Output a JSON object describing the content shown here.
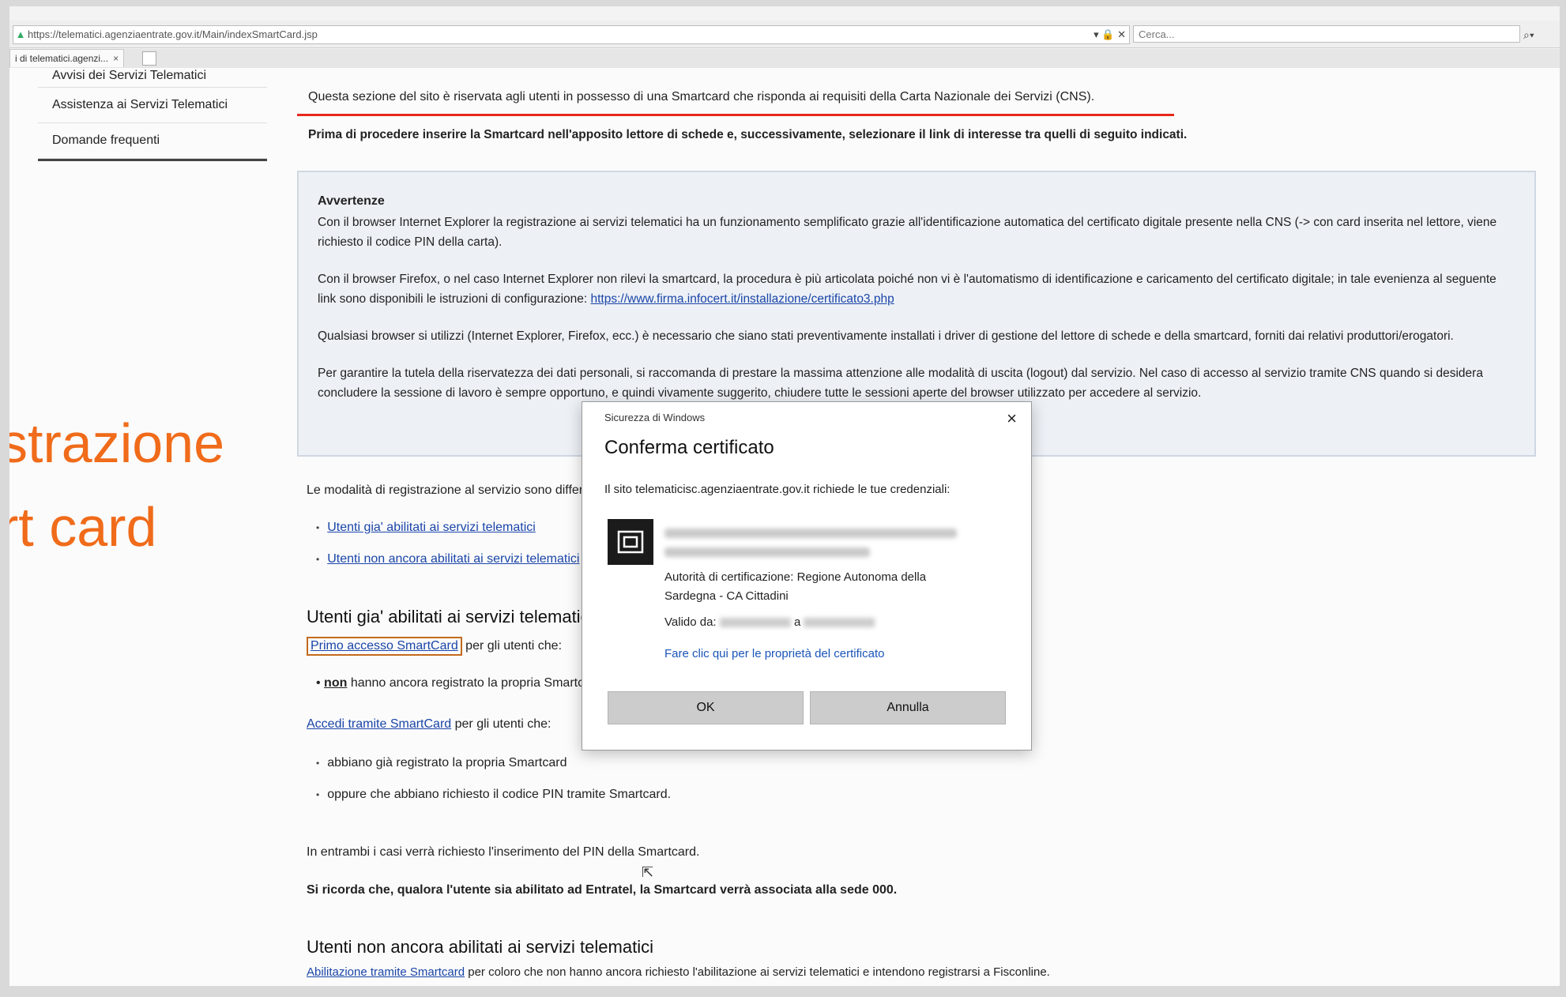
{
  "browser": {
    "url": "https://telematici.agenziaentrate.gov.it/Main/indexSmartCard.jsp",
    "url_controls": "▾ 🔒 ✕",
    "search_placeholder": "Cerca...",
    "tab_label": "i di telematici.agenzi...",
    "tab_close": "×"
  },
  "sidebar": {
    "items": [
      {
        "label": "Avvisi dei Servizi Telematici"
      },
      {
        "label": "Assistenza ai Servizi Telematici"
      },
      {
        "label": "Domande frequenti"
      }
    ]
  },
  "overlay": {
    "line1": "strazione",
    "line2": "rt card",
    "color": "#f06b1a"
  },
  "main": {
    "intro": "Questa sezione del sito è riservata agli utenti in possesso di una Smartcard che risponda ai requisiti della Carta Nazionale dei Servizi (CNS).",
    "intro_bold": "Prima di procedere inserire la Smartcard nell'apposito lettore di schede e, successivamente, selezionare il link di interesse tra quelli di seguito indicati.",
    "warn": {
      "title": "Avvertenze",
      "p1": "Con il browser Internet Explorer la registrazione ai servizi telematici ha un funzionamento semplificato grazie all'identificazione automatica del certificato digitale presente nella CNS (-> con card inserita nel lettore, viene richiesto il codice PIN della carta).",
      "p2_text": "Con il browser Firefox, o nel caso Internet Explorer non rilevi la smartcard, la procedura è più articolata poiché non vi è l'automatismo di identificazione e caricamento del certificato digitale; in tale evenienza al seguente link sono disponibili le istruzioni di configurazione: ",
      "p2_link": "https://www.firma.infocert.it/installazione/certificato3.php",
      "p3": "Qualsiasi browser si utilizzi (Internet Explorer, Firefox, ecc.) è necessario che siano stati preventivamente installati i driver di gestione del lettore di schede e della smartcard, forniti dai relativi produttori/erogatori.",
      "p4": "Per garantire la tutela della riservatezza dei dati personali, si raccomanda di prestare la massima attenzione alle modalità di uscita (logout) dal servizio. Nel caso di accesso al servizio tramite CNS quando si desidera concludere la sessione di lavoro è sempre opportuno, e quindi vivamente suggerito, chiudere tutte le sessioni aperte del browser utilizzato per accedere al servizio."
    },
    "modalita": "Le modalità di registrazione al servizio sono differenti per:",
    "mode_links": [
      {
        "label": "Utenti gia' abilitati ai servizi telematici"
      },
      {
        "label": "Utenti non ancora abilitati ai servizi telematici"
      }
    ],
    "section1_title": "Utenti gia' abilitati ai servizi telematici",
    "primo_link": "Primo accesso SmartCard",
    "primo_suffix": " per gli utenti che:",
    "primo_bullet_bold": "non",
    "primo_bullet_rest": " hanno ancora registrato la propria Smartcard.",
    "accedi_link": "Accedi tramite SmartCard",
    "accedi_suffix": " per gli utenti che:",
    "accedi_bullets": [
      {
        "label": "abbiano già registrato la propria Smartcard"
      },
      {
        "label": "oppure che abbiano richiesto il codice PIN tramite Smartcard."
      }
    ],
    "pin_note": "In entrambi i casi verrà richiesto l'inserimento del PIN della Smartcard.",
    "entratel_note": "Si ricorda che, qualora l'utente sia abilitato ad Entratel, la Smartcard verrà associata alla sede 000.",
    "section2_title": "Utenti non ancora abilitati ai servizi telematici",
    "abilitazione_link": "Abilitazione tramite Smartcard",
    "abilitazione_suffix": " per coloro che non hanno ancora richiesto l'abilitazione ai servizi telematici e intendono registrarsi a Fisconline."
  },
  "dialog": {
    "caption": "Sicurezza di Windows",
    "close": "×",
    "title": "Conferma certificato",
    "message": "Il sito telematicisc.agenziaentrate.gov.it richiede le tue credenziali:",
    "authority": "Autorità di certificazione: Regione Autonoma della Sardegna - CA Cittadini",
    "valid_from_label": "Valido da:",
    "valid_to_label": "a",
    "properties_link": "Fare clic qui per le proprietà del certificato",
    "ok_label": "OK",
    "cancel_label": "Annulla"
  }
}
